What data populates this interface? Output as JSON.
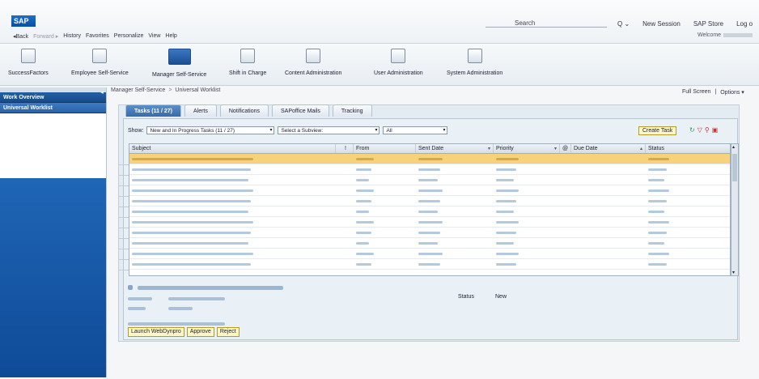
{
  "app": {
    "logo": "SAP"
  },
  "nav": {
    "back": "◂Back",
    "forward": "Forward ▸",
    "history": "History",
    "favorites": "Favorites",
    "personalize": "Personalize",
    "view": "View",
    "help": "Help"
  },
  "search": {
    "label": "Search",
    "dropdown": "Q ⌄"
  },
  "toplinks": {
    "new_session": "New Session",
    "sap_store": "SAP Store",
    "logoff": "Log o"
  },
  "welcome": {
    "text": "Welcome"
  },
  "launchpad": [
    {
      "label": "SuccessFactors"
    },
    {
      "label": "Employee Self-Service"
    },
    {
      "label": "Manager Self-Service"
    },
    {
      "label": "Shift in Charge"
    },
    {
      "label": "Content Administration"
    },
    {
      "label": "User Administration"
    },
    {
      "label": "System Administration"
    }
  ],
  "sidebar": {
    "toggle": "◂",
    "items": [
      {
        "label": "Work Overview"
      },
      {
        "label": "Universal Worklist"
      }
    ]
  },
  "breadcrumb": {
    "root": "Manager Self-Service",
    "sep": ">",
    "current": "Universal Worklist"
  },
  "pageactions": {
    "fullscreen": "Full Screen",
    "sep": "|",
    "options": "Options ▾"
  },
  "tabs": [
    {
      "label": "Tasks (11 / 27)"
    },
    {
      "label": "Alerts"
    },
    {
      "label": "Notifications"
    },
    {
      "label": "SAPoffice Mails"
    },
    {
      "label": "Tracking"
    }
  ],
  "filters": {
    "show_label": "Show:",
    "show_value": "New and In Progress Tasks (11 / 27)",
    "subview_value": "Select a Subview:",
    "all_value": "All"
  },
  "create_task": "Create Task",
  "table": {
    "columns": [
      "Subject",
      "!",
      "From",
      "Sent Date",
      "Priority",
      "@",
      "Due Date",
      "Status"
    ],
    "rows": 11
  },
  "detail": {
    "status_label": "Status",
    "status_value": "New"
  },
  "buttons": {
    "launch": "Launch WebDynpro",
    "approve": "Approve",
    "reject": "Reject"
  },
  "colors": {
    "accent": "#1f66b6",
    "selected_row": "#f7d27d",
    "button": "#fff8c6"
  }
}
